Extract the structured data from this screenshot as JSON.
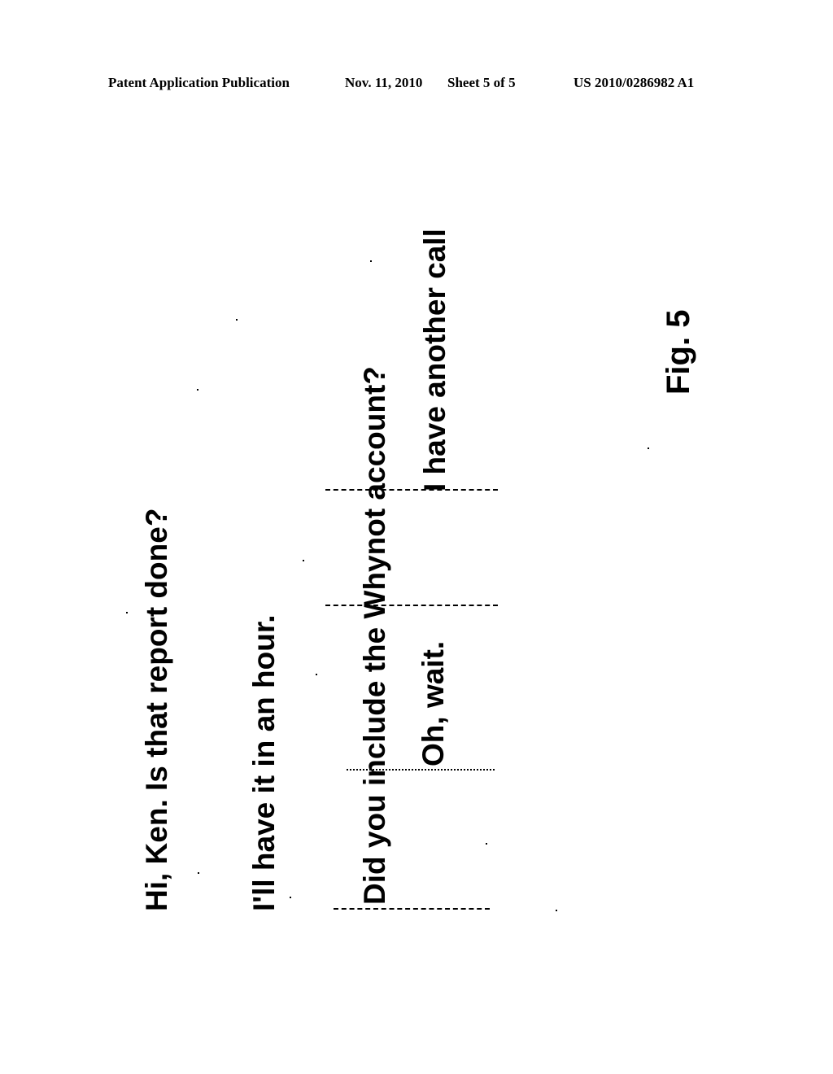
{
  "header": {
    "publication": "Patent Application Publication",
    "date": "Nov. 11, 2010",
    "sheet": "Sheet 5 of 5",
    "number": "US 2010/0286982 A1"
  },
  "figure": {
    "label": "Fig. 5",
    "utterances": [
      "Hi, Ken.  Is that report done?",
      "I'll have it in an hour.",
      "Did you include the Whynot account?",
      "Oh, wait.",
      "I have another call"
    ]
  }
}
